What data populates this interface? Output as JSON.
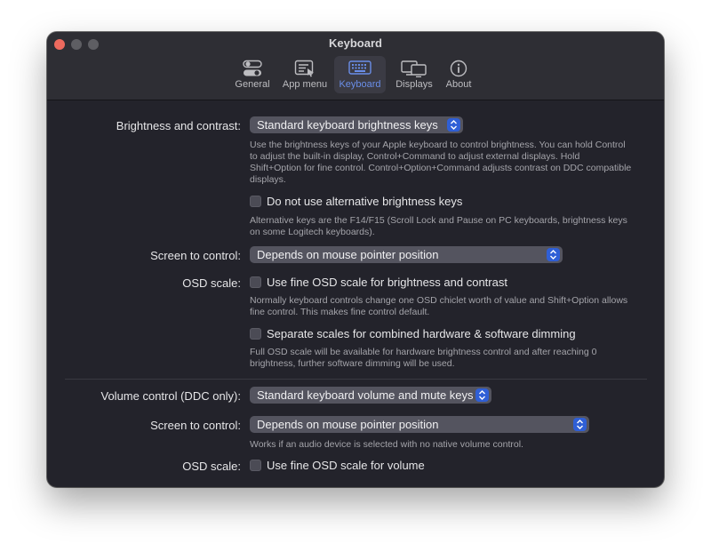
{
  "window": {
    "title": "Keyboard",
    "tabs": [
      {
        "label": "General",
        "icon": "toggles-icon",
        "active": false
      },
      {
        "label": "App menu",
        "icon": "app-menu-icon",
        "active": false
      },
      {
        "label": "Keyboard",
        "icon": "keyboard-icon",
        "active": true
      },
      {
        "label": "Displays",
        "icon": "displays-icon",
        "active": false
      },
      {
        "label": "About",
        "icon": "info-icon",
        "active": false
      }
    ]
  },
  "brightness": {
    "label": "Brightness and contrast:",
    "select_value": "Standard keyboard brightness keys",
    "description": "Use the brightness keys of your Apple keyboard to control brightness. You can hold Control to adjust the built-in display, Control+Command to adjust external displays. Hold Shift+Option for fine control. Control+Option+Command adjusts contrast on DDC compatible displays.",
    "alt_keys_checkbox": "Do not use alternative brightness keys",
    "alt_keys_checked": false,
    "alt_keys_description": "Alternative keys are the F14/F15 (Scroll Lock and Pause on PC keyboards, brightness keys on some Logitech keyboards).",
    "screen_label": "Screen to control:",
    "screen_value": "Depends on mouse pointer position",
    "osd_label": "OSD scale:",
    "osd_checkbox": "Use fine OSD scale for brightness and contrast",
    "osd_checked": false,
    "osd_description": "Normally keyboard controls change one OSD chiclet worth of value and Shift+Option allows fine control. This makes fine control default.",
    "separate_checkbox": "Separate scales for combined hardware & software dimming",
    "separate_checked": false,
    "separate_description": "Full OSD scale will be available for hardware brightness control and after reaching 0 brightness, further software dimming will be used."
  },
  "volume": {
    "label": "Volume control (DDC only):",
    "select_value": "Standard keyboard volume and mute keys",
    "screen_label": "Screen to control:",
    "screen_value": "Depends on mouse pointer position",
    "screen_description": "Works if an audio device is selected with no native volume control.",
    "osd_label": "OSD scale:",
    "osd_checkbox": "Use fine OSD scale for volume",
    "osd_checked": false
  },
  "colors": {
    "accent": "#6a8ee8",
    "stepper_blue": "#2f5fd6",
    "window_bg": "#23232b",
    "close_button": "#ed6a5e"
  }
}
